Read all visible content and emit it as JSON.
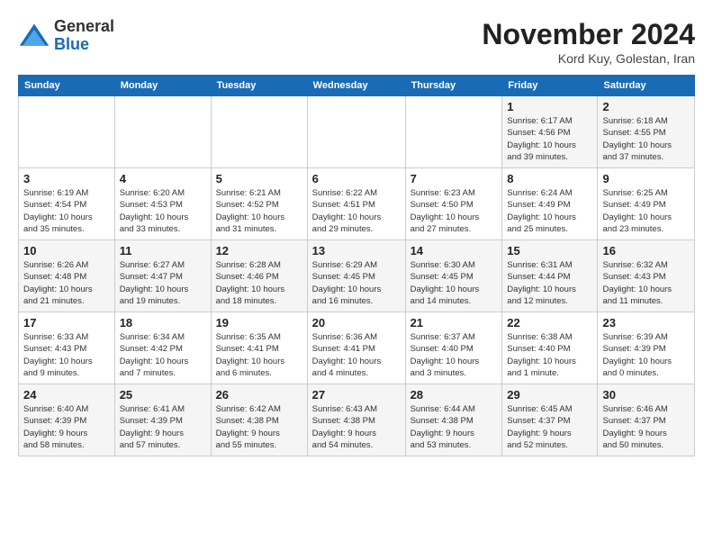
{
  "header": {
    "logo_line1": "General",
    "logo_line2": "Blue",
    "month_title": "November 2024",
    "subtitle": "Kord Kuy, Golestan, Iran"
  },
  "weekdays": [
    "Sunday",
    "Monday",
    "Tuesday",
    "Wednesday",
    "Thursday",
    "Friday",
    "Saturday"
  ],
  "weeks": [
    [
      {
        "day": "",
        "info": ""
      },
      {
        "day": "",
        "info": ""
      },
      {
        "day": "",
        "info": ""
      },
      {
        "day": "",
        "info": ""
      },
      {
        "day": "",
        "info": ""
      },
      {
        "day": "1",
        "info": "Sunrise: 6:17 AM\nSunset: 4:56 PM\nDaylight: 10 hours\nand 39 minutes."
      },
      {
        "day": "2",
        "info": "Sunrise: 6:18 AM\nSunset: 4:55 PM\nDaylight: 10 hours\nand 37 minutes."
      }
    ],
    [
      {
        "day": "3",
        "info": "Sunrise: 6:19 AM\nSunset: 4:54 PM\nDaylight: 10 hours\nand 35 minutes."
      },
      {
        "day": "4",
        "info": "Sunrise: 6:20 AM\nSunset: 4:53 PM\nDaylight: 10 hours\nand 33 minutes."
      },
      {
        "day": "5",
        "info": "Sunrise: 6:21 AM\nSunset: 4:52 PM\nDaylight: 10 hours\nand 31 minutes."
      },
      {
        "day": "6",
        "info": "Sunrise: 6:22 AM\nSunset: 4:51 PM\nDaylight: 10 hours\nand 29 minutes."
      },
      {
        "day": "7",
        "info": "Sunrise: 6:23 AM\nSunset: 4:50 PM\nDaylight: 10 hours\nand 27 minutes."
      },
      {
        "day": "8",
        "info": "Sunrise: 6:24 AM\nSunset: 4:49 PM\nDaylight: 10 hours\nand 25 minutes."
      },
      {
        "day": "9",
        "info": "Sunrise: 6:25 AM\nSunset: 4:49 PM\nDaylight: 10 hours\nand 23 minutes."
      }
    ],
    [
      {
        "day": "10",
        "info": "Sunrise: 6:26 AM\nSunset: 4:48 PM\nDaylight: 10 hours\nand 21 minutes."
      },
      {
        "day": "11",
        "info": "Sunrise: 6:27 AM\nSunset: 4:47 PM\nDaylight: 10 hours\nand 19 minutes."
      },
      {
        "day": "12",
        "info": "Sunrise: 6:28 AM\nSunset: 4:46 PM\nDaylight: 10 hours\nand 18 minutes."
      },
      {
        "day": "13",
        "info": "Sunrise: 6:29 AM\nSunset: 4:45 PM\nDaylight: 10 hours\nand 16 minutes."
      },
      {
        "day": "14",
        "info": "Sunrise: 6:30 AM\nSunset: 4:45 PM\nDaylight: 10 hours\nand 14 minutes."
      },
      {
        "day": "15",
        "info": "Sunrise: 6:31 AM\nSunset: 4:44 PM\nDaylight: 10 hours\nand 12 minutes."
      },
      {
        "day": "16",
        "info": "Sunrise: 6:32 AM\nSunset: 4:43 PM\nDaylight: 10 hours\nand 11 minutes."
      }
    ],
    [
      {
        "day": "17",
        "info": "Sunrise: 6:33 AM\nSunset: 4:43 PM\nDaylight: 10 hours\nand 9 minutes."
      },
      {
        "day": "18",
        "info": "Sunrise: 6:34 AM\nSunset: 4:42 PM\nDaylight: 10 hours\nand 7 minutes."
      },
      {
        "day": "19",
        "info": "Sunrise: 6:35 AM\nSunset: 4:41 PM\nDaylight: 10 hours\nand 6 minutes."
      },
      {
        "day": "20",
        "info": "Sunrise: 6:36 AM\nSunset: 4:41 PM\nDaylight: 10 hours\nand 4 minutes."
      },
      {
        "day": "21",
        "info": "Sunrise: 6:37 AM\nSunset: 4:40 PM\nDaylight: 10 hours\nand 3 minutes."
      },
      {
        "day": "22",
        "info": "Sunrise: 6:38 AM\nSunset: 4:40 PM\nDaylight: 10 hours\nand 1 minute."
      },
      {
        "day": "23",
        "info": "Sunrise: 6:39 AM\nSunset: 4:39 PM\nDaylight: 10 hours\nand 0 minutes."
      }
    ],
    [
      {
        "day": "24",
        "info": "Sunrise: 6:40 AM\nSunset: 4:39 PM\nDaylight: 9 hours\nand 58 minutes."
      },
      {
        "day": "25",
        "info": "Sunrise: 6:41 AM\nSunset: 4:39 PM\nDaylight: 9 hours\nand 57 minutes."
      },
      {
        "day": "26",
        "info": "Sunrise: 6:42 AM\nSunset: 4:38 PM\nDaylight: 9 hours\nand 55 minutes."
      },
      {
        "day": "27",
        "info": "Sunrise: 6:43 AM\nSunset: 4:38 PM\nDaylight: 9 hours\nand 54 minutes."
      },
      {
        "day": "28",
        "info": "Sunrise: 6:44 AM\nSunset: 4:38 PM\nDaylight: 9 hours\nand 53 minutes."
      },
      {
        "day": "29",
        "info": "Sunrise: 6:45 AM\nSunset: 4:37 PM\nDaylight: 9 hours\nand 52 minutes."
      },
      {
        "day": "30",
        "info": "Sunrise: 6:46 AM\nSunset: 4:37 PM\nDaylight: 9 hours\nand 50 minutes."
      }
    ]
  ]
}
